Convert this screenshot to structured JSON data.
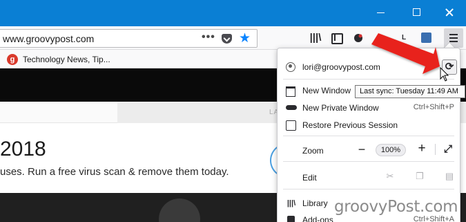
{
  "titlebar": {
    "minimize_label": "minimize",
    "maximize_label": "maximize",
    "close_label": "close"
  },
  "urlbar": {
    "url": "www.groovypost.com",
    "page_actions": "•••"
  },
  "toolbar": {
    "l_label": "L"
  },
  "bookmarks": {
    "items": [
      {
        "favicon_letter": "g",
        "label": "Technology News, Tip..."
      }
    ]
  },
  "page": {
    "nav_text": "LA",
    "year": "2018",
    "subtitle": "uses. Run a free virus scan & remove them today."
  },
  "menu": {
    "account": "lori@groovypost.com",
    "new_window": "New Window",
    "new_private_window": "New Private Window",
    "new_private_window_shortcut": "Ctrl+Shift+P",
    "restore_session": "Restore Previous Session",
    "zoom_label": "Zoom",
    "zoom_minus": "−",
    "zoom_value": "100%",
    "zoom_plus": "+",
    "edit_label": "Edit",
    "library": "Library",
    "addons": "Add-ons",
    "addons_shortcut": "Ctrl+Shift+A"
  },
  "tooltip": {
    "text": "Last sync: Tuesday 11:49 AM"
  },
  "watermark": {
    "text": "groovyPost.com"
  },
  "colors": {
    "titlebar": "#0a7fd4",
    "accent": "#0a84ff",
    "arrow": "#e8231c"
  },
  "icons": {
    "sync": "sync-icon",
    "star": "bookmark-star-icon",
    "menu": "hamburger-menu-icon"
  }
}
